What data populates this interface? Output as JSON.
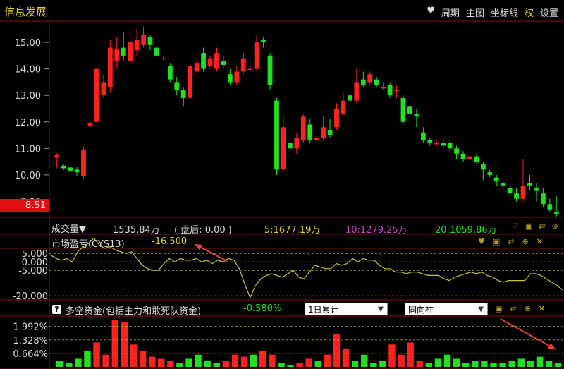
{
  "app": {
    "title": "信息发展"
  },
  "menu": {
    "items": [
      "周期",
      "主图",
      "坐标线",
      "权",
      "设置"
    ]
  },
  "price_axis": {
    "ticks": [
      "15.00",
      "14.00",
      "13.00",
      "12.00",
      "11.00",
      "10.00",
      "9.00"
    ],
    "current": "8.51"
  },
  "volume_row": {
    "label": "成交量▼",
    "value": "1535.84万",
    "after_hours": "( 盘后: 0.00 )",
    "ma5": "5:1677.19万",
    "ma10": "10:1279.25万",
    "ma20": "20:1059.86万"
  },
  "cys_panel": {
    "label": "市场盈亏(CYS13)",
    "value": "-16.500",
    "ticks": [
      "5.000",
      "0.000",
      "-5.000",
      "-20.000"
    ]
  },
  "fund_panel": {
    "help": "?",
    "label": "多空资金(包括主力和敢死队资金)",
    "value": "-0.580%",
    "period_select": "1日累计",
    "style_select": "同向柱",
    "ticks": [
      "1.992%",
      "1.328%",
      "0.664%"
    ]
  },
  "colors": {
    "up": "#ff2020",
    "down": "#20e020",
    "accent": "#e8d31a",
    "frame": "#8a1010",
    "cys_line": "#c8c820"
  },
  "chart_data": [
    {
      "type": "candlestick",
      "ylim": [
        8.4,
        15.8
      ],
      "candles": [
        [
          10.65,
          10.75,
          10.82,
          10.25
        ],
        [
          10.35,
          10.25,
          10.42,
          10.18
        ],
        [
          10.28,
          10.15,
          10.32,
          10.08
        ],
        [
          10.2,
          10.1,
          10.32,
          9.95
        ],
        [
          9.95,
          10.95,
          11.05,
          9.85
        ],
        [
          11.85,
          11.95,
          12.05,
          11.8
        ],
        [
          12.0,
          14.0,
          14.3,
          11.9
        ],
        [
          13.0,
          13.5,
          13.8,
          12.9
        ],
        [
          13.3,
          14.8,
          15.1,
          13.1
        ],
        [
          14.3,
          14.75,
          15.2,
          14.0
        ],
        [
          14.8,
          14.5,
          15.4,
          14.3
        ],
        [
          14.3,
          15.0,
          15.5,
          14.2
        ],
        [
          14.7,
          15.1,
          15.5,
          14.5
        ],
        [
          14.9,
          15.3,
          15.6,
          14.8
        ],
        [
          15.2,
          14.9,
          15.3,
          14.7
        ],
        [
          14.8,
          14.5,
          14.9,
          14.4
        ],
        [
          14.4,
          14.4,
          14.5,
          14.3
        ],
        [
          14.1,
          13.6,
          14.2,
          13.5
        ],
        [
          13.5,
          13.2,
          13.7,
          13.0
        ],
        [
          13.2,
          12.9,
          13.3,
          12.6
        ],
        [
          12.9,
          14.1,
          14.3,
          12.8
        ],
        [
          13.9,
          14.2,
          14.4,
          13.8
        ],
        [
          14.6,
          14.0,
          14.8,
          13.9
        ],
        [
          14.1,
          14.4,
          14.5,
          14.0
        ],
        [
          14.0,
          14.6,
          14.8,
          13.9
        ],
        [
          14.3,
          14.15,
          14.5,
          14.0
        ],
        [
          13.8,
          13.5,
          14.0,
          13.4
        ],
        [
          13.5,
          13.9,
          14.1,
          13.4
        ],
        [
          13.9,
          14.4,
          14.6,
          13.8
        ],
        [
          14.0,
          14.0,
          14.3,
          13.8
        ],
        [
          14.0,
          15.0,
          15.3,
          13.9
        ],
        [
          15.1,
          15.0,
          15.2,
          14.8
        ],
        [
          14.5,
          13.4,
          14.6,
          13.2
        ],
        [
          12.8,
          10.2,
          12.9,
          10.0
        ],
        [
          10.2,
          11.8,
          12.2,
          10.1
        ],
        [
          11.2,
          11.0,
          11.3,
          10.6
        ],
        [
          11.0,
          11.4,
          11.6,
          10.8
        ],
        [
          11.3,
          12.2,
          12.3,
          11.2
        ],
        [
          11.9,
          11.3,
          12.1,
          11.2
        ],
        [
          11.3,
          11.4,
          11.5,
          11.3
        ],
        [
          11.4,
          11.8,
          12.2,
          11.3
        ],
        [
          11.7,
          11.5,
          12.1,
          11.4
        ],
        [
          11.8,
          12.5,
          12.7,
          11.7
        ],
        [
          12.3,
          12.8,
          13.1,
          12.2
        ],
        [
          13.0,
          12.8,
          13.2,
          12.7
        ],
        [
          12.8,
          13.5,
          14.0,
          12.7
        ],
        [
          13.6,
          13.4,
          13.9,
          13.3
        ],
        [
          13.5,
          13.8,
          13.9,
          13.4
        ],
        [
          13.6,
          13.4,
          13.7,
          13.3
        ],
        [
          13.3,
          13.3,
          13.5,
          13.2
        ],
        [
          13.4,
          13.0,
          13.5,
          12.9
        ],
        [
          13.2,
          13.2,
          13.4,
          12.9
        ],
        [
          12.9,
          12.0,
          13.0,
          11.9
        ],
        [
          12.6,
          12.3,
          12.7,
          12.2
        ],
        [
          12.3,
          12.2,
          12.5,
          11.8
        ],
        [
          11.6,
          11.3,
          11.8,
          11.2
        ],
        [
          11.3,
          11.2,
          11.4,
          11.1
        ],
        [
          11.2,
          11.2,
          11.3,
          11.1
        ],
        [
          11.2,
          11.1,
          11.4,
          11.0
        ],
        [
          11.2,
          11.0,
          11.3,
          10.9
        ],
        [
          11.0,
          10.8,
          11.1,
          10.6
        ],
        [
          10.8,
          10.6,
          10.9,
          10.5
        ],
        [
          10.6,
          10.7,
          10.9,
          10.5
        ],
        [
          10.7,
          10.5,
          10.8,
          10.4
        ],
        [
          10.4,
          10.2,
          10.5,
          9.8
        ],
        [
          10.1,
          10.0,
          10.2,
          9.9
        ],
        [
          9.9,
          9.75,
          10.0,
          9.6
        ],
        [
          9.7,
          9.6,
          9.8,
          9.4
        ],
        [
          9.5,
          9.3,
          9.6,
          9.2
        ],
        [
          9.3,
          9.1,
          9.5,
          9.0
        ],
        [
          9.1,
          9.6,
          10.6,
          9.0
        ],
        [
          9.7,
          9.6,
          10.0,
          9.4
        ],
        [
          9.5,
          9.4,
          9.7,
          9.0
        ],
        [
          9.3,
          8.9,
          9.5,
          8.8
        ],
        [
          8.9,
          8.7,
          9.1,
          8.6
        ],
        [
          8.6,
          8.51,
          9.2,
          8.4
        ]
      ]
    },
    {
      "type": "line",
      "name": "市场盈亏(CYS13)",
      "ylim": [
        -22,
        8
      ],
      "values": [
        4,
        2,
        1,
        2,
        0,
        6,
        9,
        11,
        14,
        10,
        8,
        9,
        7,
        6,
        5,
        6,
        2,
        -2,
        -4,
        -5,
        -5,
        -1,
        2,
        0,
        2,
        1,
        1,
        2,
        0,
        1,
        -1,
        1,
        0,
        2,
        1,
        -4,
        -13,
        -21,
        -14,
        -10,
        -8,
        -7,
        -8,
        -9,
        -7,
        -5,
        -9,
        -10,
        -6,
        -2,
        -3,
        -4,
        -4,
        -1,
        -2,
        -1,
        2,
        0,
        2,
        1,
        1,
        -2,
        -4,
        -4,
        -6,
        -6,
        -7,
        -6,
        -6,
        -7,
        -8,
        -8,
        -8,
        -10,
        -11,
        -9,
        -8,
        -7,
        -6,
        -7,
        -6,
        -8,
        -9,
        -11,
        -12,
        -11,
        -11,
        -11,
        -11,
        -7,
        -7,
        -8,
        -10,
        -12,
        -14,
        -16.5
      ]
    },
    {
      "type": "bar",
      "name": "多空资金",
      "ylim": [
        0,
        2.5
      ],
      "values": [
        [
          0.3,
          "d"
        ],
        [
          0.2,
          "d"
        ],
        [
          0.4,
          "d"
        ],
        [
          0.8,
          "d"
        ],
        [
          1.2,
          "u"
        ],
        [
          0.6,
          "u"
        ],
        [
          2.3,
          "u"
        ],
        [
          2.2,
          "u"
        ],
        [
          1.1,
          "u"
        ],
        [
          0.8,
          "u"
        ],
        [
          0.5,
          "u"
        ],
        [
          0.4,
          "u"
        ],
        [
          0.3,
          "u"
        ],
        [
          0.2,
          "d"
        ],
        [
          0.4,
          "d"
        ],
        [
          0.6,
          "d"
        ],
        [
          0.3,
          "d"
        ],
        [
          0.2,
          "d"
        ],
        [
          0.3,
          "u"
        ],
        [
          0.6,
          "u"
        ],
        [
          0.5,
          "u"
        ],
        [
          0.6,
          "d"
        ],
        [
          0.8,
          "u"
        ],
        [
          0.6,
          "u"
        ],
        [
          0.2,
          "d"
        ],
        [
          0.1,
          "d"
        ],
        [
          0.2,
          "u"
        ],
        [
          0.4,
          "u"
        ],
        [
          0.3,
          "d"
        ],
        [
          0.6,
          "u"
        ],
        [
          1.6,
          "u"
        ],
        [
          0.9,
          "u"
        ],
        [
          0.3,
          "d"
        ],
        [
          0.6,
          "d"
        ],
        [
          0.2,
          "d"
        ],
        [
          0.3,
          "d"
        ],
        [
          1.1,
          "u"
        ],
        [
          0.6,
          "u"
        ],
        [
          1.2,
          "u"
        ],
        [
          0.3,
          "u"
        ],
        [
          0.2,
          "d"
        ],
        [
          0.4,
          "d"
        ],
        [
          0.6,
          "d"
        ],
        [
          0.4,
          "d"
        ],
        [
          0.2,
          "d"
        ],
        [
          0.3,
          "d"
        ],
        [
          0.3,
          "d"
        ],
        [
          0.2,
          "d"
        ],
        [
          0.2,
          "d"
        ],
        [
          0.3,
          "d"
        ],
        [
          0.4,
          "d"
        ],
        [
          0.3,
          "d"
        ],
        [
          0.5,
          "d"
        ],
        [
          0.3,
          "d"
        ],
        [
          0.2,
          "d"
        ]
      ]
    }
  ]
}
